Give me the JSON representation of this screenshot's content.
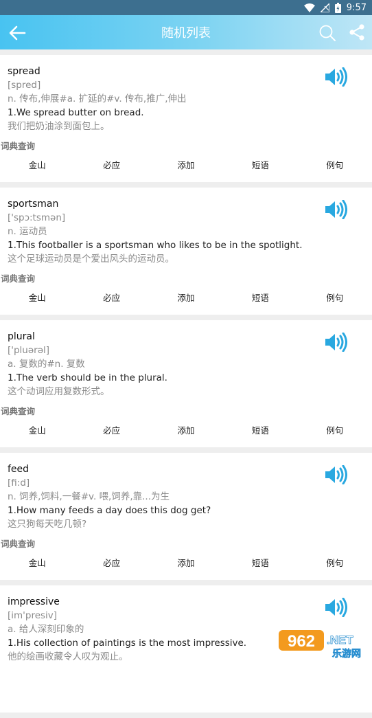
{
  "status": {
    "time": "9:57"
  },
  "appbar": {
    "title": "随机列表"
  },
  "dict_label": "词典查询",
  "actions": [
    "金山",
    "必应",
    "添加",
    "短语",
    "例句"
  ],
  "entries": [
    {
      "word": "spread",
      "phonetic": "[spred]",
      "definition": "n. 传布,伸展#a. 扩延的#v. 传布,推广,伸出",
      "example": "1.We spread butter on bread.",
      "translation": "我们把奶油涂到面包上。"
    },
    {
      "word": "sportsman",
      "phonetic": "['spɔ:tsmən]",
      "definition": "n. 运动员",
      "example": "1.This footballer is a sportsman who likes to be in the spotlight.",
      "translation": "这个足球运动员是个爱出风头的运动员。"
    },
    {
      "word": "plural",
      "phonetic": "['pluərəl]",
      "definition": "a. 复数的#n. 复数",
      "example": "1.The verb should be in the plural.",
      "translation": "这个动词应用复数形式。"
    },
    {
      "word": "feed",
      "phonetic": "[fi:d]",
      "definition": "n. 饲养,饲料,一餐#v. 喂,饲养,靠...为生",
      "example": "1.How many feeds a day does this dog get?",
      "translation": "这只狗每天吃几顿?"
    },
    {
      "word": "impressive",
      "phonetic": "[im'presiv]",
      "definition": "a. 给人深刻印象的",
      "example": "1.His collection of paintings is the most impressive.",
      "translation": "他的绘画收藏令人叹为观止。"
    }
  ],
  "watermark": {
    "number": "962",
    "suffix": ".NET",
    "site": "乐游网"
  }
}
